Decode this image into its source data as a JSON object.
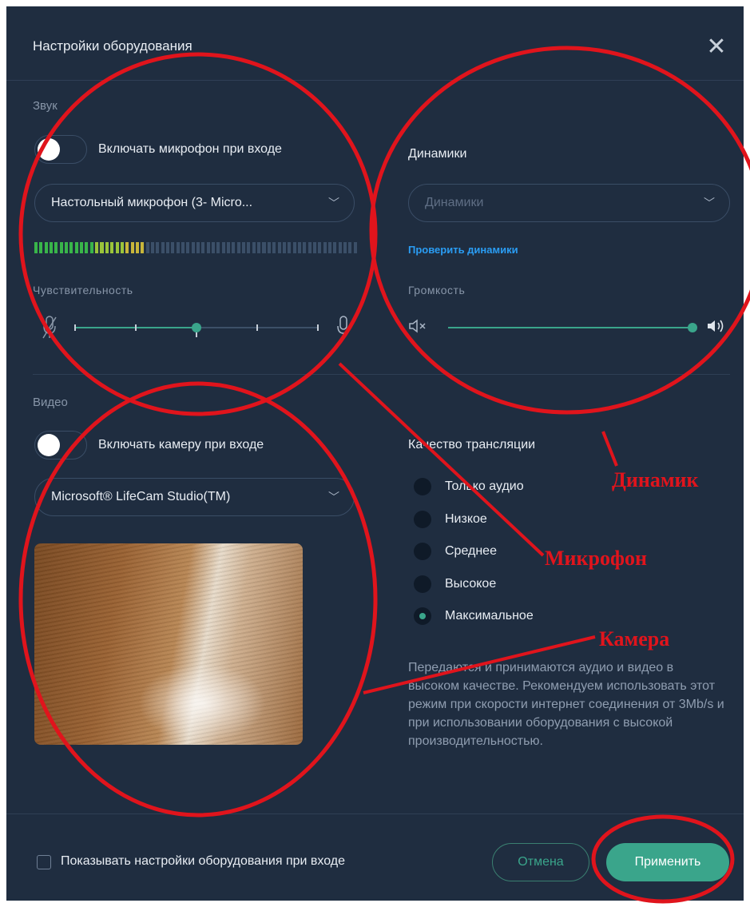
{
  "dialog": {
    "title": "Настройки оборудования",
    "close_icon": "close-icon"
  },
  "sound": {
    "section_label": "Звук",
    "mic_toggle_label": "Включать микрофон при входе",
    "mic_toggle_on": false,
    "mic_select_value": "Настольный микрофон (3- Micro...",
    "level_meter": {
      "total_bars": 64,
      "active_bars": 22
    },
    "sensitivity_label": "Чувствительность",
    "sensitivity_fraction": 0.5
  },
  "speakers": {
    "label": "Динамики",
    "select_placeholder": "Динамики",
    "test_link": "Проверить динамики",
    "volume_label": "Громкость",
    "volume_fraction": 1.0
  },
  "video": {
    "section_label": "Видео",
    "camera_toggle_label": "Включать камеру при входе",
    "camera_toggle_on": false,
    "camera_select_value": "Microsoft® LifeCam Studio(TM)"
  },
  "quality": {
    "label": "Качество трансляции",
    "options": [
      "Только аудио",
      "Низкое",
      "Среднее",
      "Высокое",
      "Максимальное"
    ],
    "selected_index": 4,
    "description": "Передаются и принимаются аудио и видео в высоком качестве. Рекомендуем использовать этот режим при скорости интернет соединения от 3Mb/s и при использовании оборудования с высокой производительностью."
  },
  "footer": {
    "show_on_join_label": "Показывать настройки оборудования при входе",
    "show_on_join_checked": false,
    "cancel_label": "Отмена",
    "apply_label": "Применить"
  },
  "annotations": {
    "speaker": "Динамик",
    "microphone": "Микрофон",
    "camera": "Камера"
  },
  "colors": {
    "dialog_bg": "#1f2d40",
    "accent": "#3aa58b",
    "link": "#2a9df4",
    "annotation_red": "#e0141c"
  }
}
